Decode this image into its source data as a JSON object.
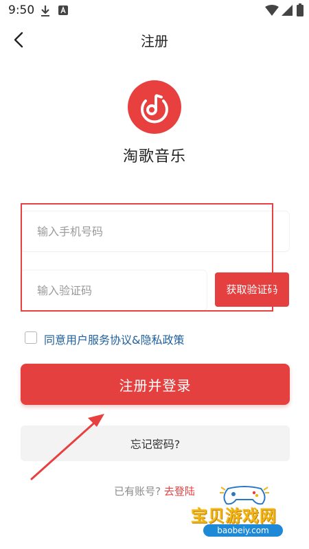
{
  "status_bar": {
    "time": "9:50",
    "icons": [
      "download-icon",
      "font-a-icon",
      "wifi-icon",
      "signal-icon",
      "battery-icon"
    ]
  },
  "header": {
    "title": "注册",
    "back_icon": "chevron-left-icon"
  },
  "app": {
    "name": "淘歌音乐",
    "logo_icon": "music-note-icon",
    "brand_color": "#e8403f"
  },
  "form": {
    "phone_placeholder": "输入手机号码",
    "phone_value": "",
    "code_placeholder": "输入验证码",
    "code_value": "",
    "get_code_label": "获取验证码",
    "agree_checked": false,
    "agree_label": "同意用户服务协议&隐私政策"
  },
  "actions": {
    "register_label": "注册并登录",
    "forgot_label": "忘记密码?",
    "login_prefix": "已有账号?",
    "login_link": "去登陆"
  },
  "colors": {
    "accent": "#e54040",
    "link": "#1f5f9c",
    "muted": "#8a8a8a",
    "secondary_button_bg": "#f3f3f3"
  },
  "watermark": {
    "title": "宝贝游戏网",
    "url": "baobeiy.com"
  }
}
